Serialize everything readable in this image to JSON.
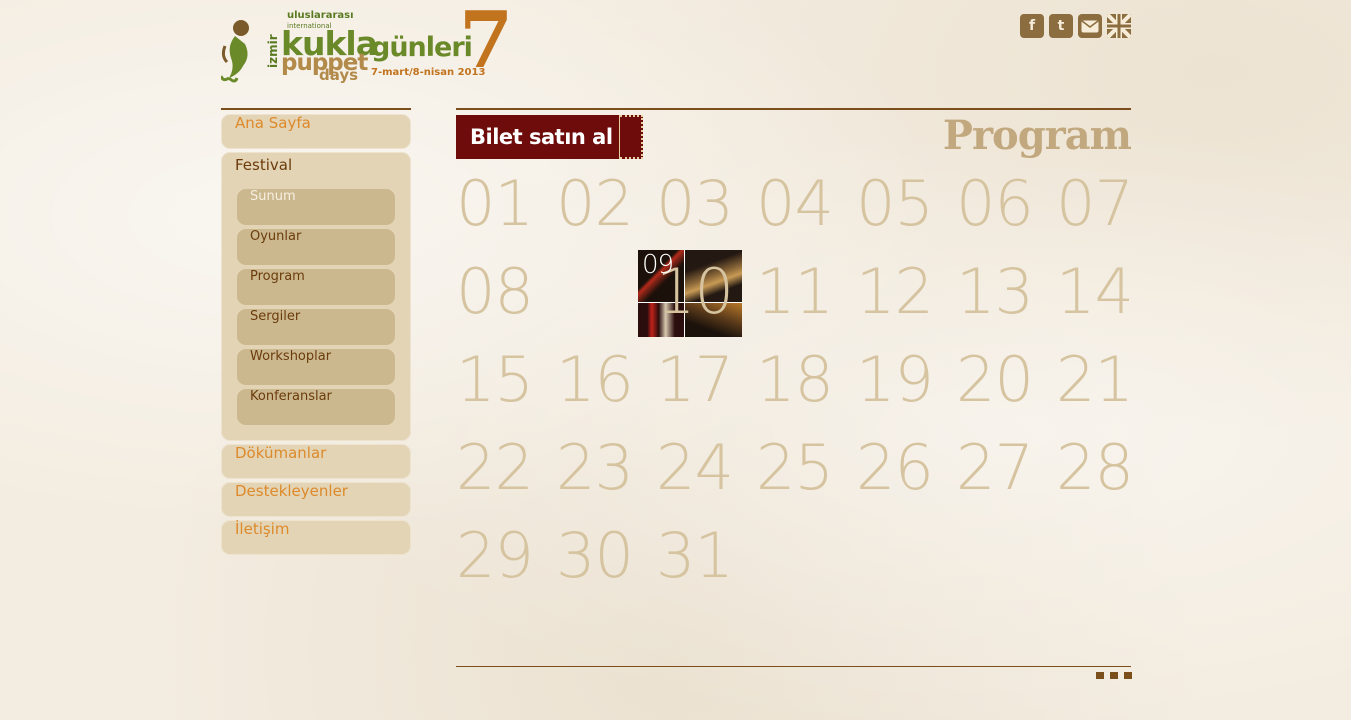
{
  "logo": {
    "line1": "uluslararası",
    "line1b": "international",
    "city": "izmir",
    "kukla": "kukla",
    "gunleri": "günleri",
    "puppet": "puppet",
    "days": "days",
    "dates": "7-mart/8-nisan 2013",
    "edition": "7"
  },
  "social": {
    "facebook": "f",
    "twitter": "t",
    "email": "email-icon",
    "language": "uk-flag-icon"
  },
  "nav": {
    "ana_sayfa": "Ana Sayfa",
    "festival": "Festival",
    "festival_items": [
      "Sunum",
      "Oyunlar",
      "Program",
      "Sergiler",
      "Workshoplar",
      "Konferanslar"
    ],
    "dokumanlar": "Dökümanlar",
    "destekleyenler": "Destekleyenler",
    "iletisim": "İletişim"
  },
  "main": {
    "bilet_label": "Bilet satın al",
    "title": "Program",
    "days": [
      "01",
      "02",
      "03",
      "04",
      "05",
      "06",
      "07",
      "08",
      "09",
      "10",
      "11",
      "12",
      "13",
      "14",
      "15",
      "16",
      "17",
      "18",
      "19",
      "20",
      "21",
      "22",
      "23",
      "24",
      "25",
      "26",
      "27",
      "28",
      "29",
      "30",
      "31"
    ],
    "highlighted_day": "09"
  },
  "colors": {
    "accent_brown": "#7a4f1c",
    "ticket_red": "#6e0b0b",
    "nav_orange": "#dd8a2a",
    "day_number": "#d6c4a0"
  }
}
